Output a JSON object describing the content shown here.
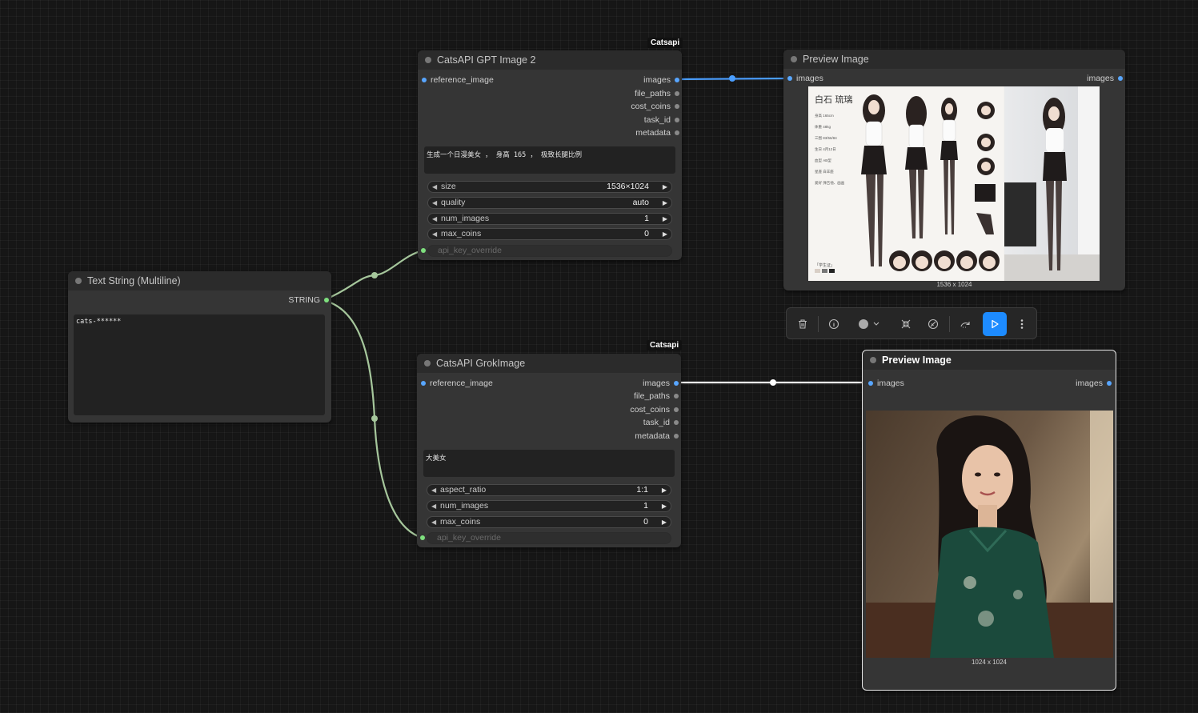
{
  "nodes": {
    "text_string": {
      "title": "Text String (Multiline)",
      "output_label": "STRING",
      "text": "cats-******"
    },
    "gpt_image": {
      "badge": "Catsapi",
      "title": "CatsAPI GPT Image 2",
      "input_label": "reference_image",
      "outputs": [
        "images",
        "file_paths",
        "cost_coins",
        "task_id",
        "metadata"
      ],
      "prompt": "生成一个日漫美女 ， 身高 165 ， 极致长腿比例",
      "widgets": [
        {
          "label": "size",
          "value": "1536×1024"
        },
        {
          "label": "quality",
          "value": "auto"
        },
        {
          "label": "num_images",
          "value": "1"
        },
        {
          "label": "max_coins",
          "value": "0"
        }
      ],
      "extra_input": "api_key_override"
    },
    "grok_image": {
      "badge": "Catsapi",
      "title": "CatsAPI GrokImage",
      "input_label": "reference_image",
      "outputs": [
        "images",
        "file_paths",
        "cost_coins",
        "task_id",
        "metadata"
      ],
      "prompt": "大美女",
      "widgets": [
        {
          "label": "aspect_ratio",
          "value": "1:1"
        },
        {
          "label": "num_images",
          "value": "1"
        },
        {
          "label": "max_coins",
          "value": "0"
        }
      ],
      "extra_input": "api_key_override"
    },
    "preview_1": {
      "title": "Preview Image",
      "input_label": "images",
      "output_label": "images",
      "image_size": "1536 x 1024",
      "image_text": {
        "name": "白石 琉璃",
        "subtitle": "「学生证」",
        "notes": [
          "身高 165cm",
          "体重 48kg",
          "三围 83/56/84",
          "生日 4月12日",
          "血型 AB型",
          "星座 白羊座",
          "爱好 弹吉他、画画"
        ]
      }
    },
    "preview_2": {
      "title": "Preview Image",
      "input_label": "images",
      "output_label": "images",
      "image_size": "1024 x 1024"
    }
  },
  "toolbar": {
    "icons": [
      "trash-icon",
      "info-icon",
      "color-icon",
      "collapse-icon",
      "bypass-icon",
      "redo-icon",
      "run-icon",
      "more-icon"
    ]
  },
  "colors": {
    "image_wire": "#4a9eff",
    "string_wire": "#a6c79c",
    "selected_wire": "#ffffff",
    "run_button": "#1d8bff"
  }
}
